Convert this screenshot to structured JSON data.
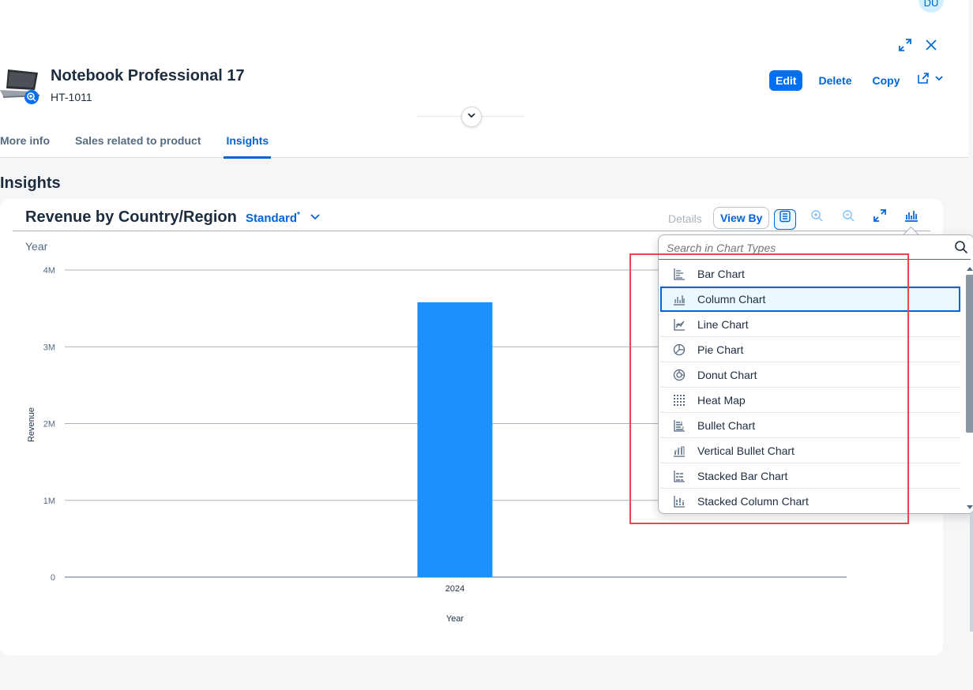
{
  "user": {
    "initials": "DU"
  },
  "object": {
    "title": "Notebook Professional 17",
    "id": "HT-1011"
  },
  "actions": {
    "edit": "Edit",
    "delete": "Delete",
    "copy": "Copy"
  },
  "tabs": [
    {
      "label": "More info"
    },
    {
      "label": "Sales related to product"
    },
    {
      "label": "Insights"
    }
  ],
  "section": {
    "title": "Insights"
  },
  "chart_card": {
    "title": "Revenue by Country/Region",
    "variant": "Standard",
    "variant_modified": "*",
    "details_label": "Details",
    "view_by_label": "View By"
  },
  "chart_data": {
    "type": "bar",
    "title": "",
    "top_axis_label": "Year",
    "xlabel": "Year",
    "ylabel": "Revenue",
    "categories": [
      "2024"
    ],
    "values": [
      3580000
    ],
    "ylim": [
      0,
      4000000
    ],
    "yticks": [
      {
        "value": 0,
        "label": "0"
      },
      {
        "value": 1000000,
        "label": "1M"
      },
      {
        "value": 2000000,
        "label": "2M"
      },
      {
        "value": 3000000,
        "label": "3M"
      },
      {
        "value": 4000000,
        "label": "4M"
      }
    ],
    "bar_color": "#1b90ff",
    "grid": true
  },
  "chart_type_menu": {
    "search_placeholder": "Search in Chart Types",
    "items": [
      {
        "label": "Bar Chart",
        "icon": "bar-chart-icon"
      },
      {
        "label": "Column Chart",
        "icon": "column-chart-icon",
        "selected": true
      },
      {
        "label": "Line Chart",
        "icon": "line-chart-icon"
      },
      {
        "label": "Pie Chart",
        "icon": "pie-chart-icon"
      },
      {
        "label": "Donut Chart",
        "icon": "donut-chart-icon"
      },
      {
        "label": "Heat Map",
        "icon": "heat-map-icon"
      },
      {
        "label": "Bullet Chart",
        "icon": "bullet-chart-icon"
      },
      {
        "label": "Vertical Bullet Chart",
        "icon": "vertical-bullet-chart-icon"
      },
      {
        "label": "Stacked Bar Chart",
        "icon": "stacked-bar-chart-icon"
      },
      {
        "label": "Stacked Column Chart",
        "icon": "stacked-column-chart-icon"
      }
    ]
  },
  "colors": {
    "accent": "#0064d9",
    "emphasized_button": "#0070f2",
    "highlight_box": "#e5484d"
  }
}
